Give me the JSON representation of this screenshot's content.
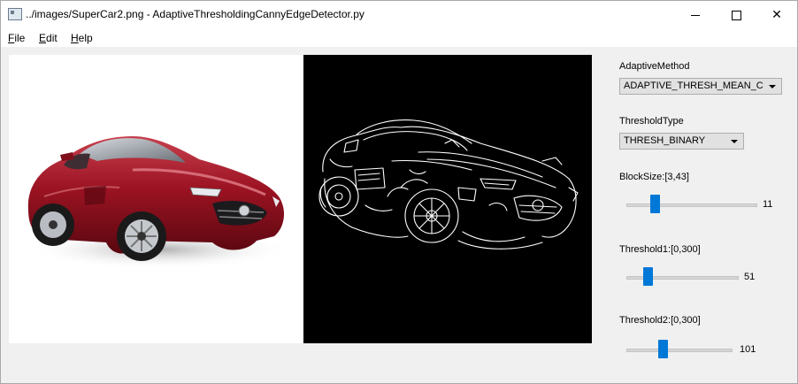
{
  "window": {
    "title": "../images/SuperCar2.png - AdaptiveThresholdingCannyEdgeDetector.py",
    "minimize_icon": "minimize-icon",
    "maximize_icon": "maximize-icon",
    "close_icon": "close-icon",
    "close_glyph": "✕"
  },
  "menu": {
    "items": [
      {
        "mnemonic": "F",
        "rest": "ile"
      },
      {
        "mnemonic": "E",
        "rest": "dit"
      },
      {
        "mnemonic": "H",
        "rest": "elp"
      }
    ]
  },
  "controls": {
    "adaptive_method": {
      "label": "AdaptiveMethod",
      "value": "ADAPTIVE_THRESH_MEAN_C"
    },
    "threshold_type": {
      "label": "ThresholdType",
      "value": "THRESH_BINARY"
    },
    "block_size": {
      "label": "BlockSize:[3,43]",
      "value": "11",
      "min": 3,
      "max": 43
    },
    "threshold1": {
      "label": "Threshold1:[0,300]",
      "value": "51",
      "min": 0,
      "max": 300
    },
    "threshold2": {
      "label": "Threshold2:[0,300]",
      "value": "101",
      "min": 0,
      "max": 300
    }
  },
  "colors": {
    "accent": "#0078d7",
    "car_red": "#9b1322",
    "edge_bg": "#000000",
    "edge_line": "#ffffff"
  }
}
